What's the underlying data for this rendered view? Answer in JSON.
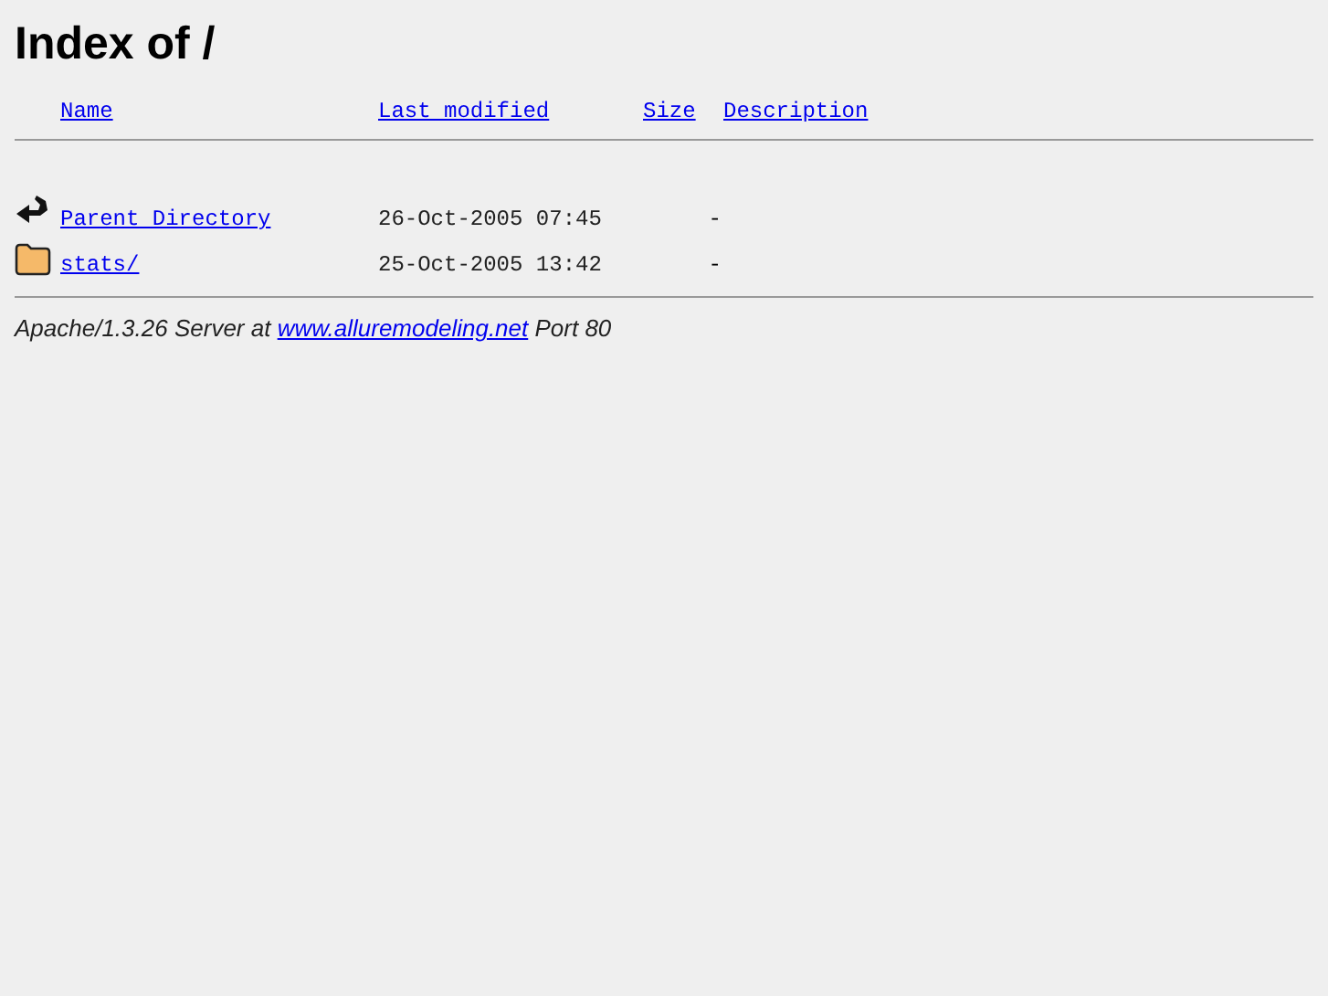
{
  "title": "Index of /",
  "columns": [
    "Name",
    "Last modified",
    "Size",
    "Description"
  ],
  "rows": [
    {
      "kind": "back",
      "name": "Parent Directory",
      "modified": "26-Oct-2005 07:45",
      "size": "-"
    },
    {
      "kind": "folder",
      "name": "stats/",
      "modified": "25-Oct-2005 13:42",
      "size": "-"
    }
  ],
  "footer": {
    "before": "Apache/1.3.26 Server at",
    "link": "www.alluremodeling.net",
    "after": "Port 80"
  }
}
